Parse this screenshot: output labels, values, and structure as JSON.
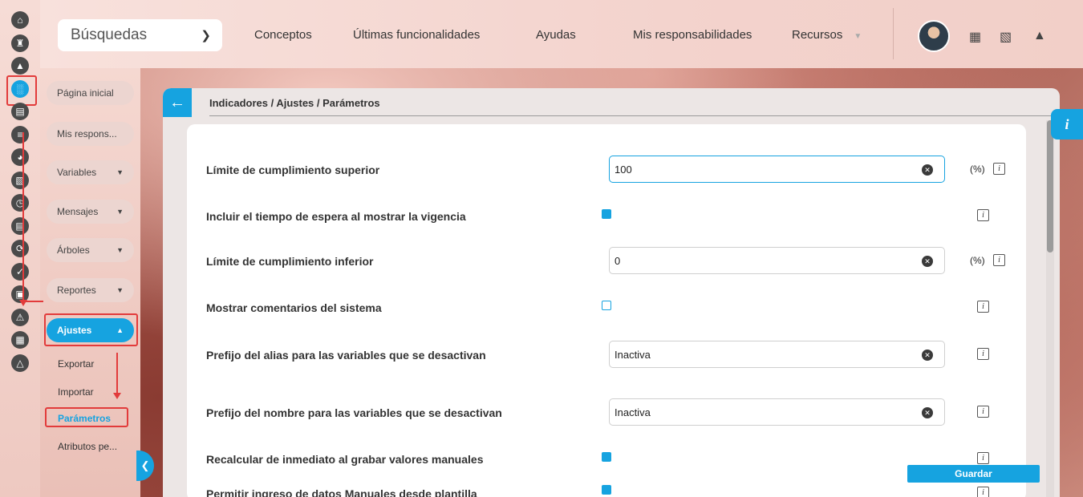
{
  "topbar": {
    "search_label": "Búsquedas",
    "nav": [
      "Conceptos",
      "Últimas funcionalidades",
      "Ayudas",
      "Mis responsabilidades",
      "Recursos"
    ]
  },
  "sidebar": {
    "items": [
      {
        "label": "Página inicial"
      },
      {
        "label": "Mis respons..."
      },
      {
        "label": "Variables"
      },
      {
        "label": "Mensajes"
      },
      {
        "label": "Árboles"
      },
      {
        "label": "Reportes"
      },
      {
        "label": "Ajustes"
      }
    ],
    "subitems": [
      "Exportar",
      "Importar",
      "Parámetros",
      "Atributos pe..."
    ]
  },
  "main": {
    "breadcrumb": "Indicadores / Ajustes / Parámetros",
    "rows": [
      {
        "label": "Límite de cumplimiento superior",
        "type": "input",
        "value": "100",
        "unit": "(%)"
      },
      {
        "label": "Incluir el tiempo de espera al mostrar la vigencia",
        "type": "checkbox",
        "checked": true
      },
      {
        "label": "Límite de cumplimiento inferior",
        "type": "input",
        "value": "0",
        "unit": "(%)"
      },
      {
        "label": "Mostrar comentarios del sistema",
        "type": "checkbox",
        "checked": false
      },
      {
        "label": "Prefijo del alias para las variables que se desactivan",
        "type": "input",
        "value": "Inactiva"
      },
      {
        "label": "Prefijo del nombre para las variables que se desactivan",
        "type": "input",
        "value": "Inactiva"
      },
      {
        "label": "Recalcular de inmediato al grabar valores manuales",
        "type": "checkbox",
        "checked": true
      },
      {
        "label": "Permitir ingreso de datos Manuales desde plantilla",
        "type": "checkbox",
        "checked": true
      }
    ],
    "save_label": "Guardar"
  },
  "icons": {
    "info": "i",
    "help": "i"
  },
  "colors": {
    "accent": "#16a3e0",
    "annotation": "#e23b3b"
  }
}
